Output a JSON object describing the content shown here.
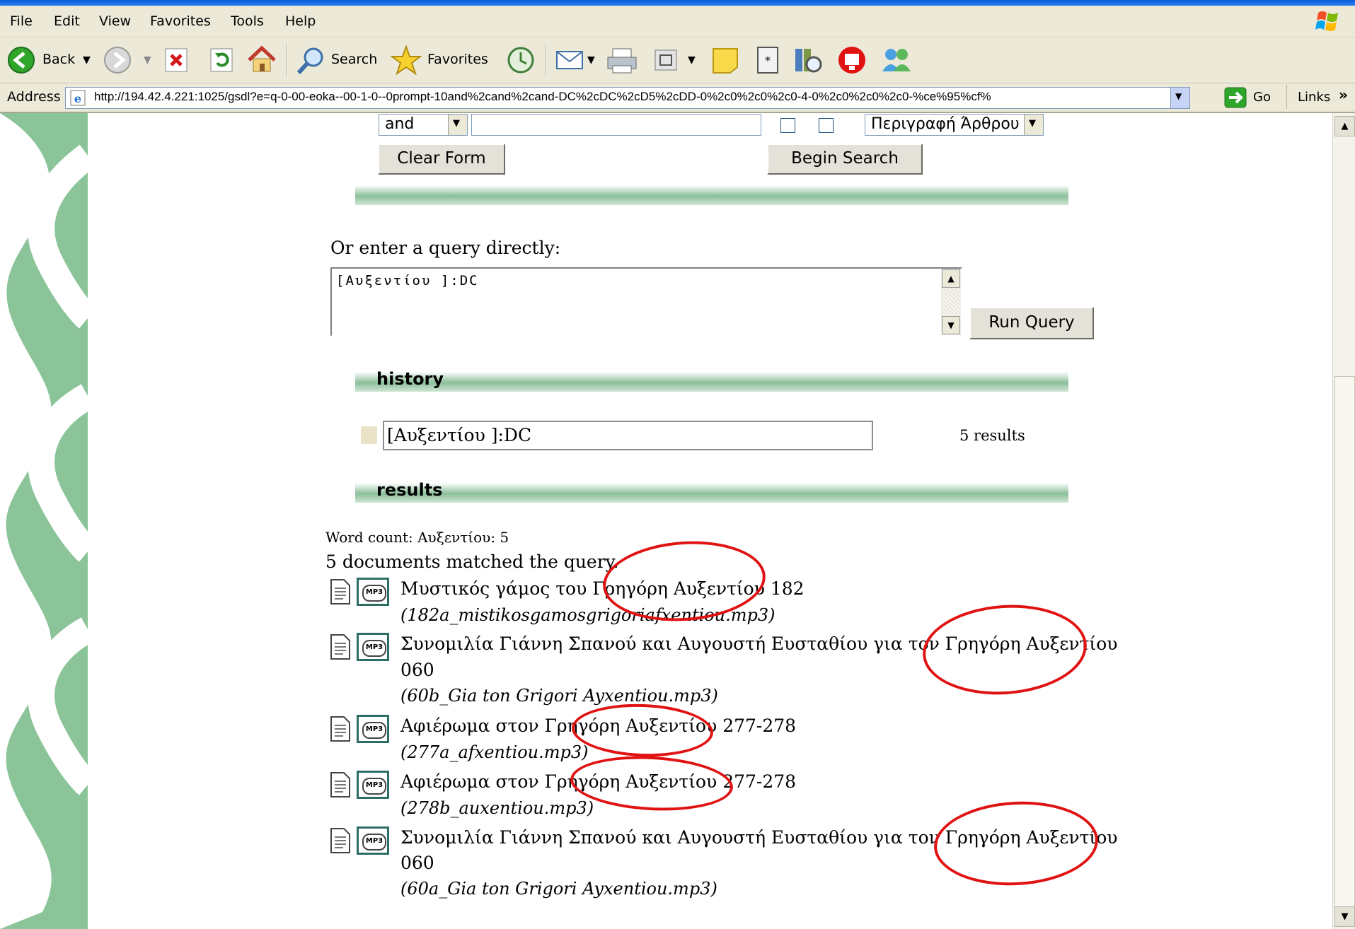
{
  "menu": {
    "items": [
      "File",
      "Edit",
      "View",
      "Favorites",
      "Tools",
      "Help"
    ]
  },
  "toolbar": {
    "back_label": "Back",
    "search_label": "Search",
    "favorites_label": "Favorites"
  },
  "address": {
    "label": "Address",
    "url": "http://194.42.4.221:1025/gsdl?e=q-0-00-eoka--00-1-0--0prompt-10and%2cand%2cand-DC%2cDC%2cD5%2cDD-0%2c0%2c0%2c0-4-0%2c0%2c0%2c0-%ce%95%cf%",
    "go_label": "Go",
    "links_label": "Links"
  },
  "form": {
    "combo_value": "and",
    "field_value": "Περιγραφή Άρθρου",
    "clear_label": "Clear Form",
    "begin_label": "Begin Search"
  },
  "query": {
    "prompt": "Or enter a query directly:",
    "text": "[Αυξεντίου ]:DC",
    "run_label": "Run Query"
  },
  "history": {
    "heading": "history",
    "entry": "[Αυξεντίου ]:DC",
    "count": "5 results"
  },
  "results": {
    "heading": "results",
    "word_count": "Word count: Αυξεντίου: 5",
    "matched": "5 documents matched the query.",
    "items": [
      {
        "title": "Μυστικός γάμος του Γρηγόρη Αυξεντίου 182",
        "title2": "",
        "file": "(182a_mistikosgamosgrigoriafxentiou.mp3)"
      },
      {
        "title": "Συνομιλία Γιάννη Σπανού και Αυγουστή Ευσταθίου για τον Γρηγόρη Αυξεντίου",
        "title2": "060",
        "file": "(60b_Gia ton Grigori Ayxentiou.mp3)"
      },
      {
        "title": "Αφιέρωμα στον Γρηγόρη Αυξεντίου 277-278",
        "title2": "",
        "file": "(277a_afxentiou.mp3)"
      },
      {
        "title": "Αφιέρωμα στον Γρηγόρη Αυξεντίου 277-278",
        "title2": "",
        "file": "(278b_auxentiou.mp3)"
      },
      {
        "title": "Συνομιλία Γιάννη Σπανού και Αυγουστή Ευσταθίου για τον Γρηγόρη Αυξεντίου",
        "title2": "060",
        "file": "(60a_Gia ton Grigori Ayxentiou.mp3)"
      }
    ]
  },
  "icons": {
    "mp3_badge": "MP3"
  },
  "colors": {
    "band_green": "#8cbf9a",
    "ribbon_green": "#8cc49a",
    "annotation_red": "#e01212"
  }
}
